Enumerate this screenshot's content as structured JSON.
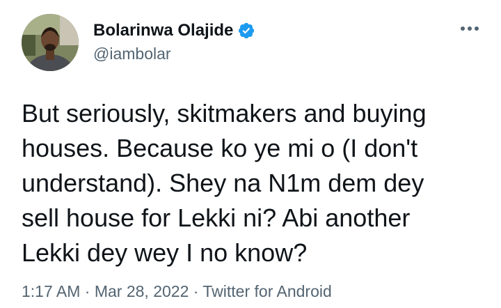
{
  "user": {
    "display_name": "Bolarinwa Olajide",
    "handle": "@iambolar",
    "verified": true
  },
  "icons": {
    "verified": "verified-badge-icon",
    "more": "more-options-icon"
  },
  "colors": {
    "verified_blue": "#1d9bf0",
    "text": "#0f1419",
    "secondary": "#536471"
  },
  "tweet": {
    "lines": [
      "But seriously, skitmakers and buying",
      "houses. Because ko ye mi o (I don't",
      "understand). Shey na N1m dem dey",
      "sell house for Lekki ni? Abi another",
      "Lekki dey wey I no know?"
    ]
  },
  "meta": {
    "time": "1:17 AM",
    "separator": " · ",
    "date": "Mar 28, 2022",
    "source": "Twitter for Android"
  }
}
